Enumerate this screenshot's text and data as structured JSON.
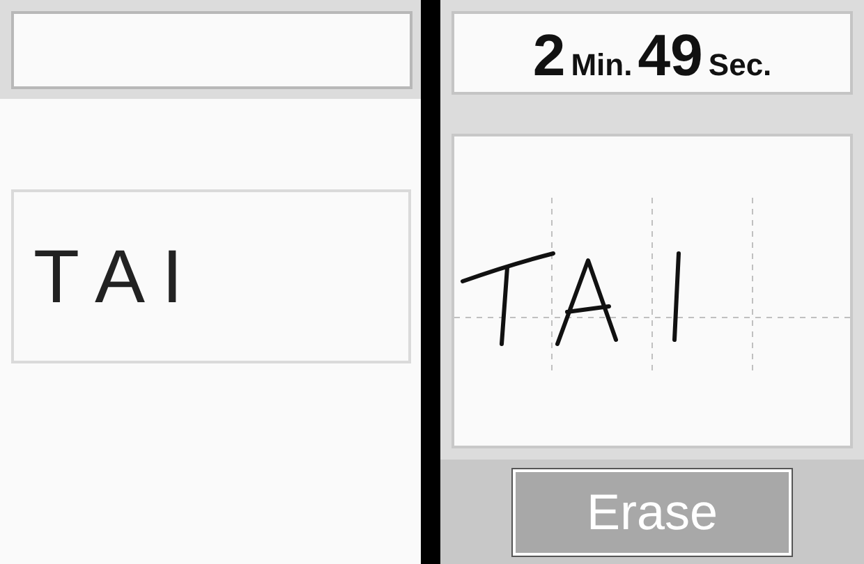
{
  "top_screen": {
    "word": "T A I"
  },
  "touch_screen": {
    "timer": {
      "minutes": "2",
      "minutes_unit": "Min.",
      "seconds": "49",
      "seconds_unit": "Sec."
    },
    "erase_button": "Erase"
  }
}
